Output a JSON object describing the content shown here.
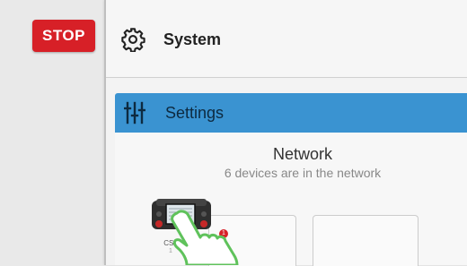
{
  "stop_button": {
    "label": "STOP"
  },
  "system": {
    "title": "System",
    "icon": "gear-icon"
  },
  "settings": {
    "label": "Settings",
    "icon": "sliders-icon",
    "color": "#3a93d1"
  },
  "network": {
    "title": "Network",
    "subtitle": "6 devices are in the network",
    "devices": [
      {
        "label": "CS3",
        "sublabel": "1",
        "badge": "1"
      }
    ]
  },
  "colors": {
    "stop": "#d72027",
    "accent": "#3a93d1",
    "pointer": "#5fc25b"
  }
}
